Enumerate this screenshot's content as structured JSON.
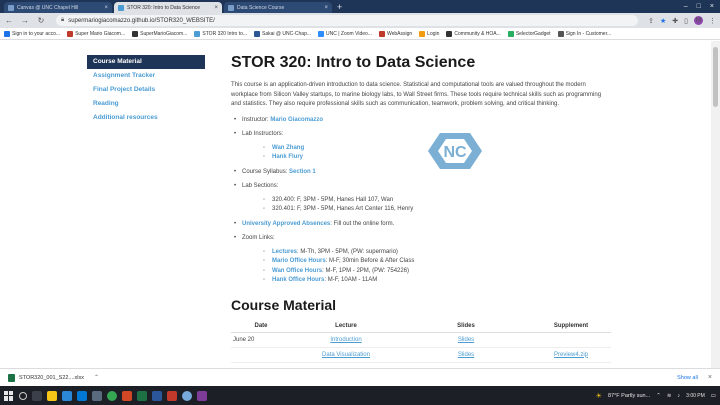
{
  "browser": {
    "tabs": [
      {
        "label": "Canvas @ UNC Chapel Hill"
      },
      {
        "label": "STOR 320: Intro to Data Science"
      },
      {
        "label": "Data Science Course"
      }
    ],
    "url": "supermariogiacomazzo.github.io/STOR320_WEBSITE/",
    "bookmarks": [
      {
        "label": "Sign in to your acco...",
        "color": "#1a73e8"
      },
      {
        "label": "Super Mario Giacom...",
        "color": "#c0392b"
      },
      {
        "label": "SuperMarioGiacom...",
        "color": "#333333"
      },
      {
        "label": "STOR 320 Intro to...",
        "color": "#4b9cd3"
      },
      {
        "label": "Sakai @ UNC-Chap...",
        "color": "#2b5797"
      },
      {
        "label": "UNC | Zoom Video...",
        "color": "#2d8cff"
      },
      {
        "label": "WebAssign",
        "color": "#c0392b"
      },
      {
        "label": "Login",
        "color": "#f39c12"
      },
      {
        "label": "Community & HOA...",
        "color": "#333333"
      },
      {
        "label": "SelectorGadget",
        "color": "#27ae60"
      },
      {
        "label": "Sign In - Customer...",
        "color": "#555555"
      }
    ]
  },
  "sidebar": {
    "items": [
      {
        "label": "Course Material",
        "active": true
      },
      {
        "label": "Assignment Tracker",
        "active": false
      },
      {
        "label": "Final Project Details",
        "active": false
      },
      {
        "label": "Reading",
        "active": false
      },
      {
        "label": "Additional resources",
        "active": false
      }
    ]
  },
  "main": {
    "title": "STOR 320: Intro to Data Science",
    "intro": "This course is an application-driven introduction to data science. Statistical and computational tools are valued throughout the modern workplace from Silicon Valley startups, to marine biology labs, to Wall Street firms. These tools require technical skills such as programming and statistics. They also require professional skills such as communication, teamwork, problem solving, and critical thinking.",
    "instructor_label": "Instructor:",
    "instructor_name": "Mario Giacomazzo",
    "lab_instructors_label": "Lab Instructors:",
    "lab_instructors": [
      "Wan Zhang",
      "Hank Flury"
    ],
    "syllabus_label": "Course Syllabus:",
    "syllabus_link": "Section 1",
    "lab_sections_label": "Lab Sections:",
    "lab_sections": [
      "320.400: F, 3PM - 5PM, Hanes Hall 107, Wan",
      "320.401: F, 3PM - 5PM, Hanes Art Center 116, Henry"
    ],
    "absences_link": "University Approved Absences",
    "absences_text": ": Fill out the online form.",
    "zoom_label": "Zoom Links:",
    "zoom_links": [
      {
        "name": "Lectures",
        "text": ": M-Th, 3PM - 5PM, (PW: supermario)"
      },
      {
        "name": "Mario Office Hours",
        "text": ": M-F, 30min Before & After Class"
      },
      {
        "name": "Wan Office Hours",
        "text": ": M-F, 1PM - 2PM, (PW: 754226)"
      },
      {
        "name": "Hank Office Hours",
        "text": ": M-F, 10AM - 11AM"
      }
    ],
    "logo_icon": "unc-nc-logo-icon",
    "logo_color": "#7BAFD4",
    "course_material_heading": "Course Material",
    "table": {
      "headers": [
        "Date",
        "Lecture",
        "Slides",
        "Supplement"
      ],
      "rows": [
        {
          "date": "June 20",
          "lecture": "Introduction",
          "slides": "Slides",
          "supplement": ""
        },
        {
          "date": "",
          "lecture": "Data Visualization",
          "slides": "Slides",
          "supplement": "Preview4.zip"
        }
      ]
    }
  },
  "downloads": {
    "file_name": "STOR320_001_S22....xlsx",
    "show_all": "Show all"
  },
  "taskbar": {
    "weather": "87°F  Partly sun...",
    "time": "3:00 PM",
    "date": ""
  },
  "colors": {
    "unc_blue": "#4b9cd3",
    "navy": "#1f3557"
  }
}
